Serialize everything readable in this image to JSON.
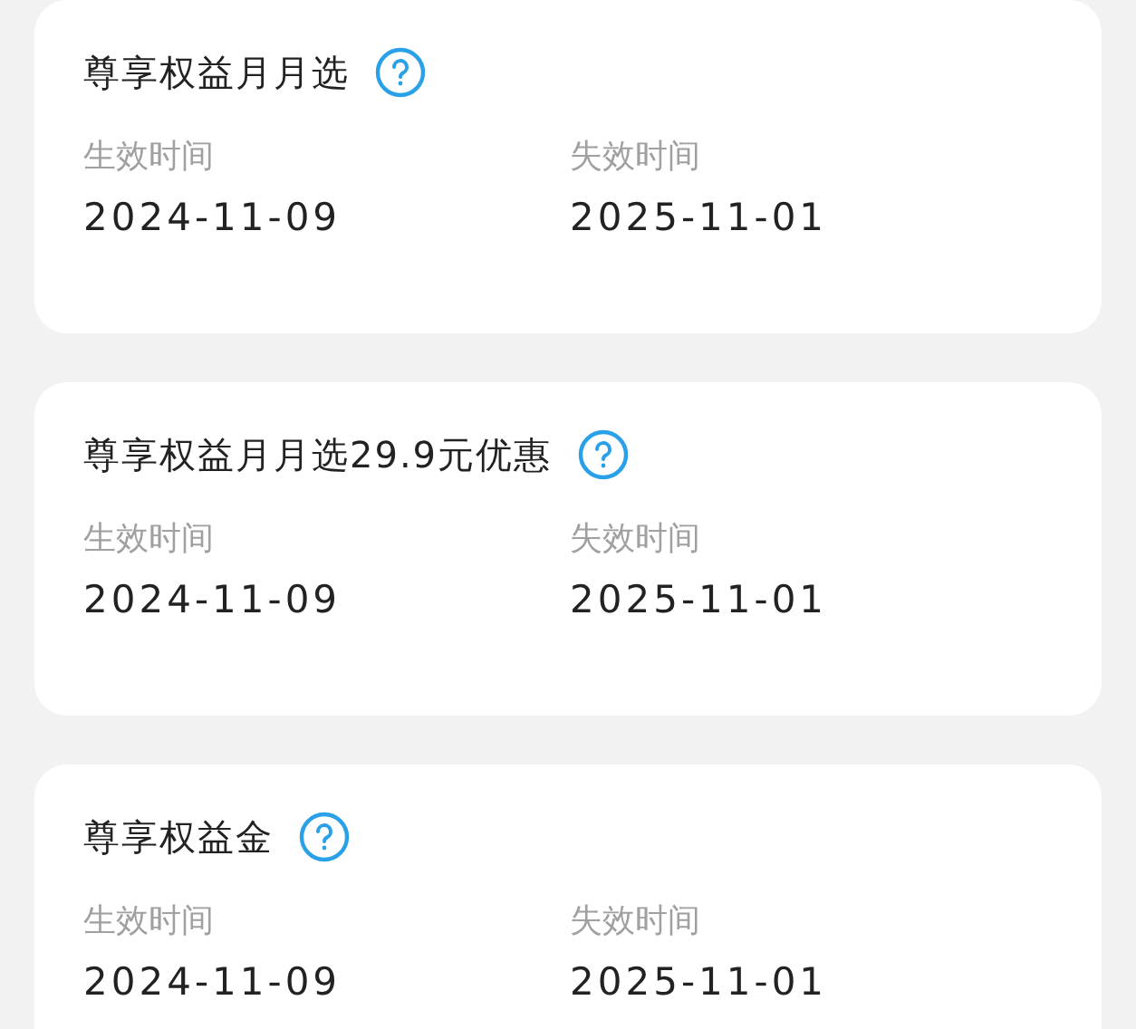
{
  "cards": [
    {
      "title": "尊享权益月月选",
      "start_label": "生效时间",
      "start_date": "2024-11-09",
      "end_label": "失效时间",
      "end_date": "2025-11-01"
    },
    {
      "title": "尊享权益月月选29.9元优惠",
      "start_label": "生效时间",
      "start_date": "2024-11-09",
      "end_label": "失效时间",
      "end_date": "2025-11-01"
    },
    {
      "title": "尊享权益金",
      "start_label": "生效时间",
      "start_date": "2024-11-09",
      "end_label": "失效时间",
      "end_date": "2025-11-01"
    }
  ]
}
